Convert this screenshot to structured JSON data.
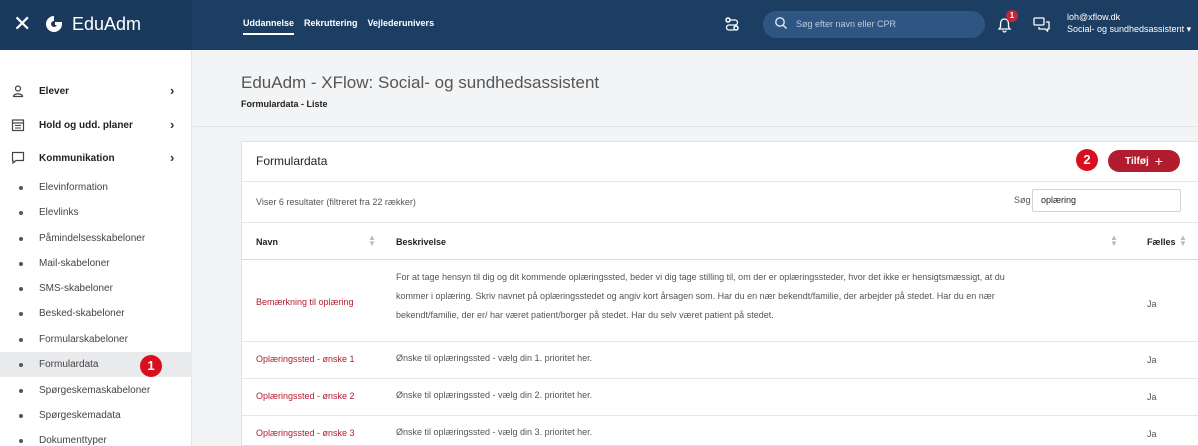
{
  "app": {
    "name": "EduAdm",
    "nav": [
      "Uddannelse",
      "Rekruttering",
      "Vejlederunivers"
    ],
    "search_placeholder": "Søg efter navn eller CPR",
    "notifications_count": "1",
    "user_email": "loh@xflow.dk",
    "user_role": "Social- og sundhedsassistent"
  },
  "colors": {
    "topbar": "#1c3e63",
    "accent": "#b21c2f",
    "marker": "#d80f1f"
  },
  "sidebar": {
    "main": [
      {
        "label": "Elever",
        "icon": "person-icon"
      },
      {
        "label": "Hold og udd. planer",
        "icon": "calendar-icon"
      },
      {
        "label": "Kommunikation",
        "icon": "chat-icon"
      }
    ],
    "sub": [
      "Elevinformation",
      "Elevlinks",
      "Påmindelsesskabeloner",
      "Mail-skabeloner",
      "SMS-skabeloner",
      "Besked-skabeloner",
      "Formularskabeloner",
      "Formulardata",
      "Spørgeskemaskabeloner",
      "Spørgeskemadata",
      "Dokumenttyper"
    ]
  },
  "markers": [
    "1",
    "2"
  ],
  "page": {
    "title": "EduAdm - XFlow: Social- og sundhedsassistent",
    "subtitle": "Formulardata - Liste"
  },
  "card": {
    "title": "Formulardata",
    "add_label": "Tilføj",
    "add_icon": "+",
    "result_info": "Viser 6 resultater (filtreret fra 22 rækker)",
    "search_label": "Søg",
    "search_value": "oplæring"
  },
  "table": {
    "headers": [
      "Navn",
      "Beskrivelse",
      "Fælles"
    ],
    "rows": [
      {
        "name": "Bemærkning til oplæring",
        "desc_lines": [
          "For at tage hensyn til dig og dit kommende oplæringssted, beder vi dig tage stilling til, om der er oplæringssteder, hvor det ikke er hensigtsmæssigt, at du",
          "kommer i oplæring. Skriv navnet på oplæringsstedet og angiv kort årsagen som. Har du en nær bekendt/familie, der arbejder på stedet. Har du en nær",
          "bekendt/familie, der er/ har været patient/borger på stedet. Har du selv været patient på stedet."
        ],
        "faelles": "Ja"
      },
      {
        "name": "Oplæringssted - ønske 1",
        "desc_lines": [
          "Ønske til oplæringssted - vælg din 1. prioritet her."
        ],
        "faelles": "Ja"
      },
      {
        "name": "Oplæringssted - ønske 2",
        "desc_lines": [
          "Ønske til oplæringssted - vælg din 2. prioritet her."
        ],
        "faelles": "Ja"
      },
      {
        "name": "Oplæringssted - ønske 3",
        "desc_lines": [
          "Ønske til oplæringssted - vælg din 3. prioritet her."
        ],
        "faelles": "Ja"
      }
    ]
  }
}
